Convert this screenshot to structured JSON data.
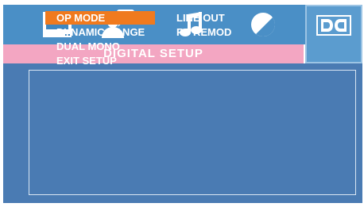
{
  "tabs": [
    {
      "icon": "tv-monitor-icon"
    },
    {
      "icon": "speaker-person-icon"
    },
    {
      "icon": "music-note-icon"
    },
    {
      "icon": "video-contrast-icon"
    },
    {
      "icon": "dolby-digital-icon",
      "selected": true
    }
  ],
  "title": "DIGITAL  SETUP",
  "menu": {
    "items": [
      "OP MODE",
      "DYNAMIC RANGE",
      "DUAL MONO",
      "EXIT SETUP"
    ],
    "selected": "OP MODE"
  },
  "options": [
    "LINE OUT",
    "RF REMOD"
  ],
  "colors": {
    "tabbar": "#4a8fc6",
    "titlebar": "#f3a6c2",
    "panel": "#4a7bb3",
    "highlight": "#f07a1e",
    "text": "#ffffff"
  }
}
